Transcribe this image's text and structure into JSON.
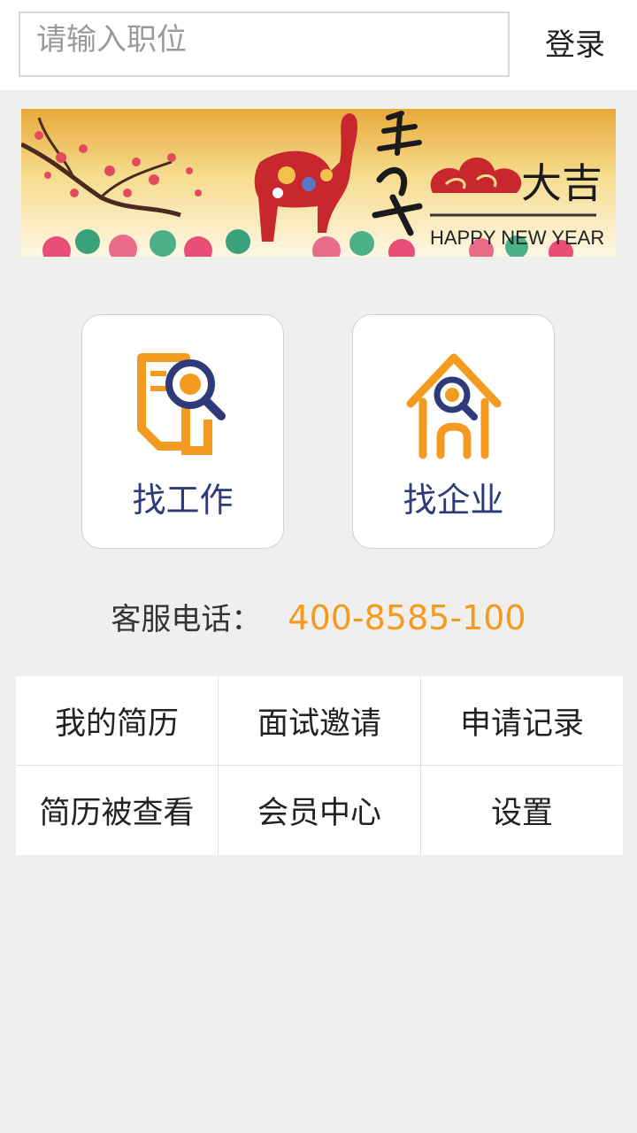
{
  "search": {
    "placeholder": "请输入职位",
    "value": ""
  },
  "header": {
    "login_label": "登录"
  },
  "banner": {
    "title_vertical": "羊年",
    "title_horizontal": "大吉",
    "subtitle": "HAPPY NEW YEAR"
  },
  "tiles": [
    {
      "label": "找工作",
      "icon": "job-search-icon"
    },
    {
      "label": "找企业",
      "icon": "company-search-icon"
    }
  ],
  "hotline": {
    "label": "客服电话：",
    "number": "400-8585-100"
  },
  "menu": [
    {
      "label": "我的简历"
    },
    {
      "label": "面试邀请"
    },
    {
      "label": "申请记录"
    },
    {
      "label": "简历被查看"
    },
    {
      "label": "会员中心"
    },
    {
      "label": "设置"
    }
  ],
  "colors": {
    "accent_orange": "#f39a21",
    "navy": "#2e3a79",
    "background": "#efefed"
  }
}
